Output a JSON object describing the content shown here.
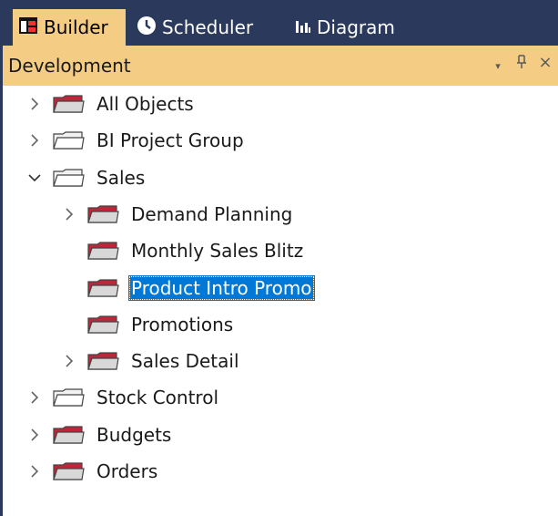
{
  "tabs": [
    {
      "label": "Builder",
      "icon": "builder-icon",
      "active": true
    },
    {
      "label": "Scheduler",
      "icon": "clock-icon",
      "active": false
    },
    {
      "label": "Diagram",
      "icon": "bar-chart-icon",
      "active": false
    }
  ],
  "panel": {
    "title": "Development",
    "dropdown_glyph": "▾",
    "pin_glyph": "⊥",
    "close_glyph": "×"
  },
  "tree": [
    {
      "label": "All Objects",
      "expander": "collapsed",
      "folder": "red"
    },
    {
      "label": "BI Project Group",
      "expander": "collapsed",
      "folder": "plain"
    },
    {
      "label": "Sales",
      "expander": "expanded",
      "folder": "plain"
    },
    {
      "label": "Demand Planning",
      "expander": "collapsed",
      "folder": "red"
    },
    {
      "label": "Monthly Sales Blitz",
      "expander": "none",
      "folder": "red"
    },
    {
      "label": "Product Intro Promo",
      "expander": "none",
      "folder": "red",
      "selected": true
    },
    {
      "label": "Promotions",
      "expander": "none",
      "folder": "red"
    },
    {
      "label": "Sales Detail",
      "expander": "collapsed",
      "folder": "red"
    },
    {
      "label": "Stock Control",
      "expander": "collapsed",
      "folder": "plain"
    },
    {
      "label": "Budgets",
      "expander": "collapsed",
      "folder": "red"
    },
    {
      "label": "Orders",
      "expander": "collapsed",
      "folder": "red"
    }
  ],
  "colors": {
    "chrome": "#2b3a5c",
    "active_tab": "#f5cc84",
    "selection": "#0078d7",
    "folder_red": "#c0263a",
    "folder_plain": "#f2f2f2"
  }
}
